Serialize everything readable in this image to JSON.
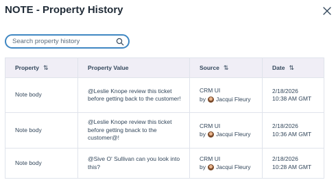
{
  "dialog": {
    "title": "NOTE - Property History",
    "close_icon": "close-icon"
  },
  "search": {
    "placeholder": "Search property history",
    "icon": "search-icon"
  },
  "table": {
    "headers": {
      "property": "Property",
      "value": "Property Value",
      "source": "Source",
      "date": "Date"
    },
    "sort_glyph": "⇅",
    "rows": [
      {
        "property": "Note body",
        "value": "@Leslie Knope review this ticket before getting back to the customer!",
        "source": "CRM UI",
        "by": "by",
        "user": "Jacqui Fleury",
        "date": "2/18/2026",
        "time": "10:38 AM GMT"
      },
      {
        "property": "Note body",
        "value": "@Leslie Knope review this ticket before getting bnack to the customer@!",
        "source": "CRM UI",
        "by": "by",
        "user": "Jacqui Fleury",
        "date": "2/18/2026",
        "time": "10:36 AM GMT"
      },
      {
        "property": "Note body",
        "value": "@Sive O' Sullivan can you look into this?",
        "source": "CRM UI",
        "by": "by",
        "user": "Jacqui Fleury",
        "date": "2/18/2026",
        "time": "10:28 AM GMT"
      }
    ]
  },
  "colors": {
    "accent": "#3e86c2",
    "header_bg": "#f0eef6",
    "border": "#dfe3eb",
    "text": "#33475b"
  }
}
